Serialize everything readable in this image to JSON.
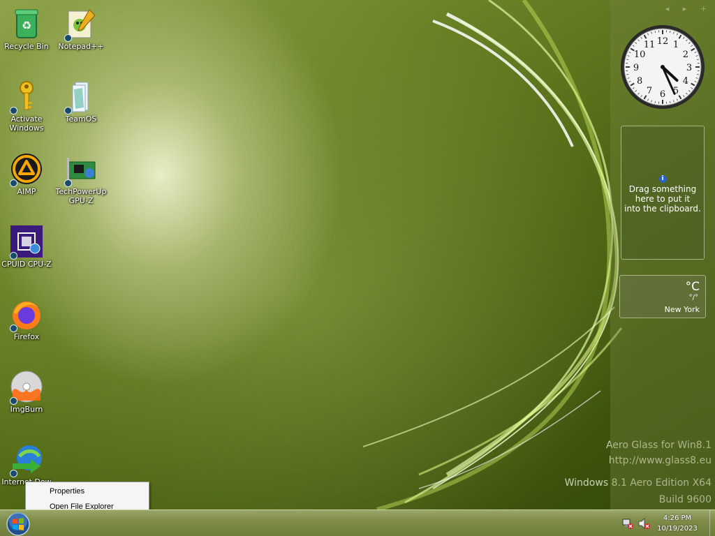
{
  "desktop": {
    "icons": [
      {
        "label": "Recycle Bin",
        "icon": "recycle-bin-icon"
      },
      {
        "label": "Notepad++",
        "icon": "notepad-plus-plus-icon"
      },
      {
        "label": "Activate Windows",
        "icon": "key-icon"
      },
      {
        "label": "TeamOS",
        "icon": "teamos-icon"
      },
      {
        "label": "AIMP",
        "icon": "aimp-icon"
      },
      {
        "label": "TechPowerUp GPU-Z",
        "icon": "gpu-z-icon"
      },
      {
        "label": "CPUID CPU-Z",
        "icon": "cpu-z-icon"
      },
      {
        "label": "Firefox",
        "icon": "firefox-icon"
      },
      {
        "label": "ImgBurn",
        "icon": "imgburn-icon"
      },
      {
        "label": "Internet Dow",
        "icon": "internet-download-manager-icon"
      }
    ]
  },
  "sidebar": {
    "controls": "◂ ▸ +",
    "clock": {
      "hour": 4,
      "minute": 26
    },
    "clipboard": {
      "text_1": "Drag something",
      "text_2": "here to put it",
      "text_3": "into the clipboard."
    },
    "weather": {
      "temp": "°C",
      "hilo": "°/°",
      "city": "New York"
    }
  },
  "watermark": {
    "line1": "Aero Glass for Win8.1",
    "line2": "http://www.glass8.eu",
    "line3": "Windows 8.1 Aero Edition X64",
    "line4": "Build 9600"
  },
  "context_menu": {
    "items": [
      {
        "label": "Properties"
      },
      {
        "label": "Open File Explorer"
      }
    ]
  },
  "taskbar": {
    "time": "4:26 PM",
    "date": "10/19/2023",
    "tray_icons": [
      "network-disconnected-icon",
      "speaker-muted-icon"
    ]
  }
}
